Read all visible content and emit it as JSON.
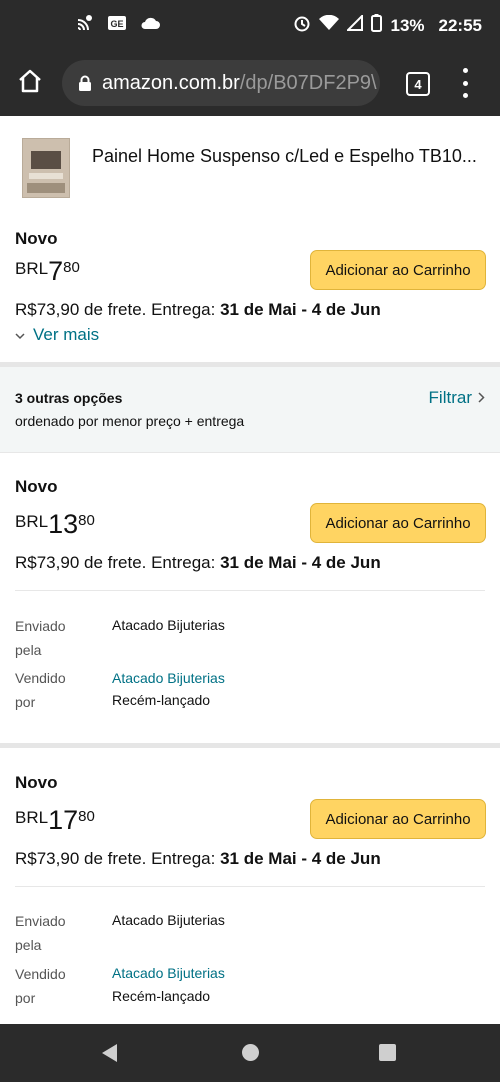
{
  "status_bar": {
    "battery": "13%",
    "time": "22:55"
  },
  "browser": {
    "url_domain": "amazon.com.br",
    "url_path": "/dp/B07DF2P9\\",
    "tab_count": "4"
  },
  "product": {
    "title": "Painel Home Suspenso c/Led e Espelho TB10..."
  },
  "main_offer": {
    "condition": "Novo",
    "currency": "BRL",
    "price_whole": "7",
    "price_fraction": "80",
    "add_to_cart": "Adicionar ao Carrinho",
    "shipping_prefix": "R$73,90 de frete. Entrega: ",
    "delivery": "31 de Mai - 4 de Jun",
    "see_more": "Ver mais"
  },
  "options": {
    "title": "3 outras opções",
    "subtitle": "ordenado por menor preço + entrega",
    "filter": "Filtrar"
  },
  "offers": [
    {
      "condition": "Novo",
      "currency": "BRL",
      "price_whole": "13",
      "price_fraction": "80",
      "add_to_cart": "Adicionar ao Carrinho",
      "shipping_prefix": "R$73,90 de frete. Entrega: ",
      "delivery": "31 de Mai - 4 de Jun",
      "shipped_by_label": "Enviado pela",
      "shipped_by": "Atacado Bijuterias",
      "sold_by_label": "Vendido por",
      "sold_by": "Atacado Bijuterias",
      "seller_status": "Recém-lançado"
    },
    {
      "condition": "Novo",
      "currency": "BRL",
      "price_whole": "17",
      "price_fraction": "80",
      "add_to_cart": "Adicionar ao Carrinho",
      "shipping_prefix": "R$73,90 de frete. Entrega: ",
      "delivery": "31 de Mai - 4 de Jun",
      "shipped_by_label": "Enviado pela",
      "shipped_by": "Atacado Bijuterias",
      "sold_by_label": "Vendido por",
      "sold_by": "Atacado Bijuterias",
      "seller_status": "Recém-lançado"
    }
  ],
  "colors": {
    "link": "#007185",
    "button": "#ffd462",
    "chrome": "#2b2b2b"
  },
  "icons": [
    "cast-icon",
    "ge-icon",
    "cloud-icon",
    "alarm-icon",
    "wifi-icon",
    "signal-icon",
    "battery-icon",
    "home-icon",
    "lock-icon",
    "tabs-icon",
    "menu-icon",
    "chevron-down-icon",
    "chevron-right-icon",
    "back-icon",
    "home-nav-icon",
    "recents-icon"
  ]
}
